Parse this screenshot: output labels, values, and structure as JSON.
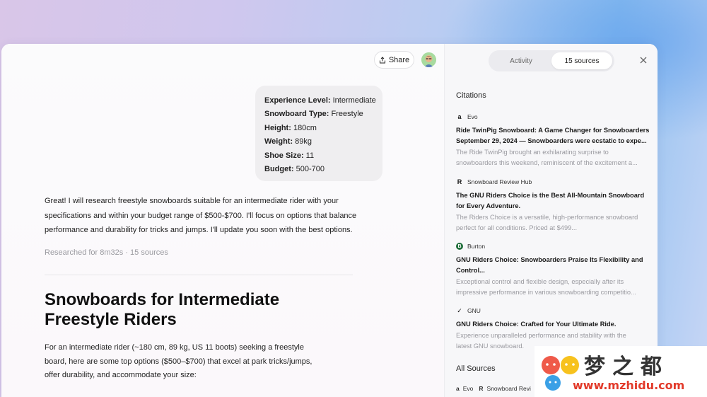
{
  "header": {
    "share_label": "Share"
  },
  "user_message": {
    "rows": [
      {
        "key": "Experience Level:",
        "value": " Intermediate"
      },
      {
        "key": "Snowboard Type:",
        "value": " Freestyle"
      },
      {
        "key": "Height:",
        "value": " 180cm"
      },
      {
        "key": "Weight:",
        "value": " 89kg"
      },
      {
        "key": "Shoe Size:",
        "value": " 11"
      },
      {
        "key": "Budget:",
        "value": " 500-700"
      }
    ]
  },
  "assistant_reply": "Great! I will research freestyle snowboards suitable for an intermediate rider with your specifications and within your budget range of $500-$700. I'll focus on options that balance performance and durability for tricks and jumps. I'll update you soon with the best options.",
  "research_meta": "Researched for 8m32s · 15 sources",
  "report": {
    "title": "Snowboards for Intermediate Freestyle Riders",
    "intro": "For an intermediate rider (~180 cm, 89 kg, US 11 boots) seeking a freestyle board, here are some top options ($500–$700) that excel at park tricks/jumps, offer durability, and accommodate your size:"
  },
  "panel": {
    "tabs": [
      "Activity",
      "15 sources"
    ],
    "active_tab": 1,
    "citations_label": "Citations",
    "all_sources_label": "All Sources",
    "citations": [
      {
        "source": "Evo",
        "icon": "amazon-icon",
        "title_1": "Ride TwinPig Snowboard: A Game Changer for Snowboarders",
        "title_2": "September 29, 2024 — Snowboarders were ecstatic to expe...",
        "desc_1": "The Ride TwinPig brought an exhilarating surprise to",
        "desc_2": "snowboarders this weekend, reminiscent of the excitement a..."
      },
      {
        "source": "Snowboard Review Hub",
        "icon": "review-hub-icon",
        "title_1": "The GNU Riders Choice is the Best All-Mountain Snowboard",
        "title_2": "for Every Adventure.",
        "desc_1": "The Riders Choice is a versatile, high-performance snowboard",
        "desc_2": "perfect for all conditions. Priced at $499..."
      },
      {
        "source": "Burton",
        "icon": "burton-icon",
        "title_1": "GNU Riders Choice: Snowboarders Praise Its Flexibility and",
        "title_2": "Control...",
        "desc_1": "Exceptional control and flexible design, especially after its",
        "desc_2": "impressive performance in various snowboarding competitio..."
      },
      {
        "source": "GNU",
        "icon": "nike-icon",
        "title_1": "GNU Riders Choice: Crafted for Your Ultimate Ride.",
        "title_2": "",
        "desc_1": "Experience unparalleled performance and stability with the",
        "desc_2": "latest GNU snowboard."
      }
    ],
    "all_sources": [
      "Evo",
      "Snowboard Revi"
    ]
  },
  "watermark": {
    "cn": "梦之都",
    "url": "www.mzhidu.com"
  },
  "colors": {
    "accent_red": "#e23a2a",
    "muted": "#9a9aa0"
  }
}
